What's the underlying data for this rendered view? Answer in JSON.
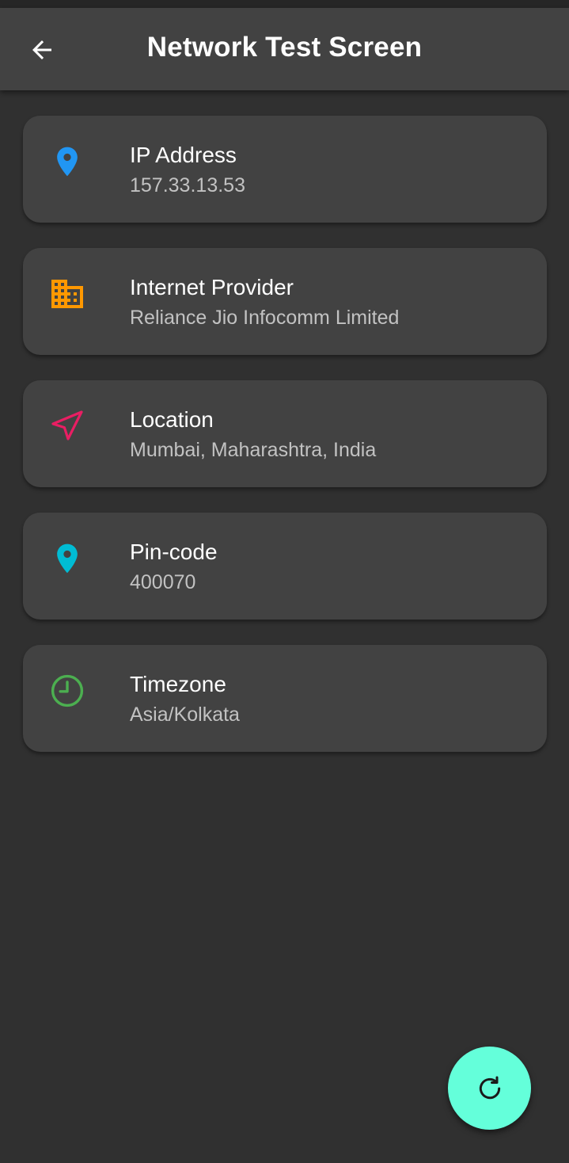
{
  "app_bar": {
    "title": "Network Test Screen",
    "back_icon": "arrow-back-icon"
  },
  "cards": [
    {
      "title": "IP Address",
      "value": "157.33.13.53",
      "icon": "location-pin-icon",
      "icon_color": "#2196f3"
    },
    {
      "title": "Internet Provider",
      "value": "Reliance Jio Infocomm Limited",
      "icon": "business-icon",
      "icon_color": "#ff9800"
    },
    {
      "title": "Location",
      "value": "Mumbai, Maharashtra, India",
      "icon": "navigation-icon",
      "icon_color": "#e91e63"
    },
    {
      "title": "Pin-code",
      "value": "400070",
      "icon": "location-pin-icon",
      "icon_color": "#00bcd4"
    },
    {
      "title": "Timezone",
      "value": "Asia/Kolkata",
      "icon": "clock-icon",
      "icon_color": "#4caf50"
    }
  ],
  "fab": {
    "icon": "refresh-icon",
    "color": "#64ffda"
  },
  "colors": {
    "background": "#303030",
    "app_bar": "#424242",
    "card": "#424242"
  }
}
